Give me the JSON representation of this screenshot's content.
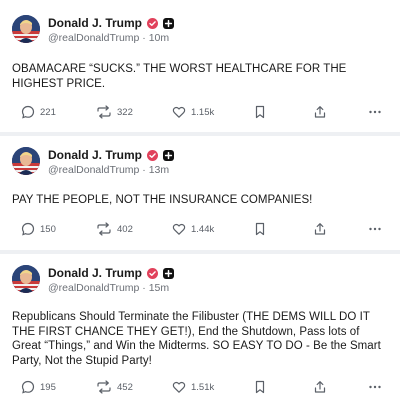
{
  "colors": {
    "verified_badge": "#e1415b",
    "follow_badge": "#111111",
    "icon": "#5b6068",
    "divider": "#eef0f3"
  },
  "posts": [
    {
      "author": "Donald J. Trump",
      "handle_time": "@realDonaldTrump · 10m",
      "text": "OBAMACARE “SUCKS.” THE WORST HEALTHCARE FOR THE HIGHEST PRICE.",
      "replies": "221",
      "reposts": "322",
      "likes": "1.15k",
      "icons": [
        "reply-icon",
        "repost-icon",
        "like-icon",
        "bookmark-icon",
        "share-icon",
        "more-icon"
      ]
    },
    {
      "author": "Donald J. Trump",
      "handle_time": "@realDonaldTrump · 13m",
      "text": "PAY THE PEOPLE,  NOT THE INSURANCE COMPANIES!",
      "replies": "150",
      "reposts": "402",
      "likes": "1.44k",
      "icons": [
        "reply-icon",
        "repost-icon",
        "like-icon",
        "bookmark-icon",
        "share-icon",
        "more-icon"
      ]
    },
    {
      "author": "Donald J. Trump",
      "handle_time": "@realDonaldTrump · 15m",
      "text": "Republicans Should Terminate the Filibuster (THE DEMS WILL DO IT THE FIRST CHANCE THEY GET!), End the Shutdown, Pass lots of Great “Things,” and Win the Midterms. SO EASY TO DO - Be the Smart Party, Not the Stupid Party!",
      "replies": "195",
      "reposts": "452",
      "likes": "1.51k",
      "icons": [
        "reply-icon",
        "repost-icon",
        "like-icon",
        "bookmark-icon",
        "share-icon",
        "more-icon"
      ]
    }
  ]
}
